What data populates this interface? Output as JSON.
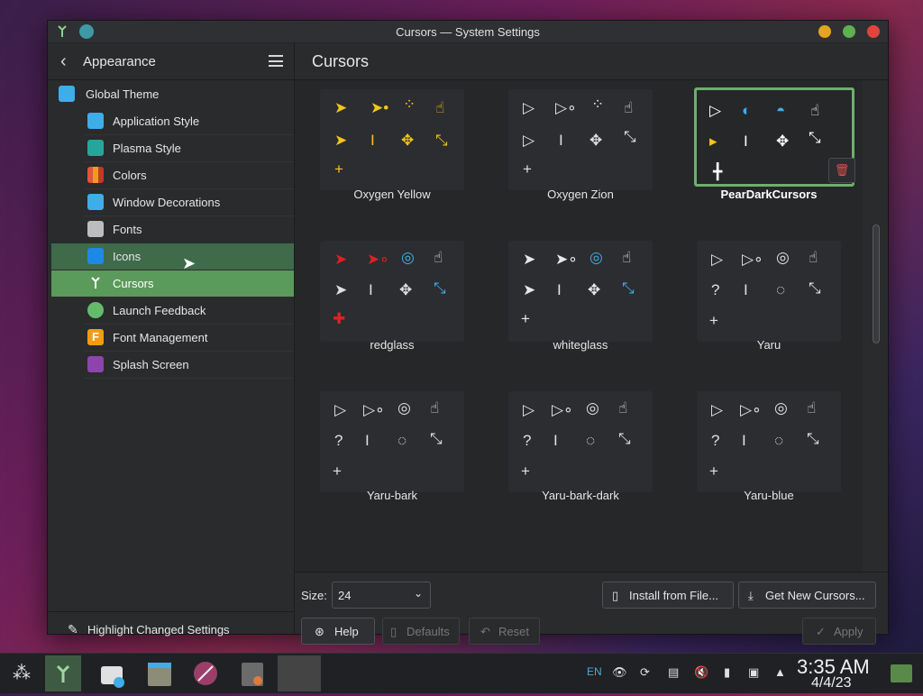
{
  "window": {
    "title": "Cursors — System Settings",
    "buttons": [
      "minimize",
      "maximize",
      "close"
    ]
  },
  "sidebar": {
    "back_icon": "chevron-left-icon",
    "title": "Appearance",
    "menu_icon": "hamburger-icon",
    "items": [
      {
        "label": "Global Theme",
        "icon": "global-theme-icon",
        "color": "#3daee9"
      },
      {
        "label": "Application Style",
        "icon": "application-style-icon",
        "color": "#3daee9"
      },
      {
        "label": "Plasma Style",
        "icon": "plasma-style-icon",
        "color": "#26a69a"
      },
      {
        "label": "Colors",
        "icon": "colors-icon",
        "color": "#e5533d"
      },
      {
        "label": "Window Decorations",
        "icon": "window-decorations-icon",
        "color": "#3daee9"
      },
      {
        "label": "Fonts",
        "icon": "fonts-icon",
        "color": "#9e9e9e"
      },
      {
        "label": "Icons",
        "icon": "icons-icon",
        "color": "#1e88e5"
      },
      {
        "label": "Cursors",
        "icon": "cursors-icon",
        "color": "#e8e8e8"
      },
      {
        "label": "Launch Feedback",
        "icon": "launch-feedback-icon",
        "color": "#66bb6a"
      },
      {
        "label": "Font Management",
        "icon": "font-management-icon",
        "color": "#f39c12"
      },
      {
        "label": "Splash Screen",
        "icon": "splash-screen-icon",
        "color": "#8e44ad"
      }
    ],
    "active": "Cursors",
    "hovered": "Icons",
    "footer": {
      "label": "Highlight Changed Settings",
      "icon": "pen-icon"
    }
  },
  "main": {
    "title": "Cursors",
    "themes": [
      {
        "name": "Oxygen Yellow",
        "color": "#f5c518",
        "selected": false
      },
      {
        "name": "Oxygen Zion",
        "color": "#e0e0e0",
        "selected": false
      },
      {
        "name": "PearDarkCursors",
        "color": "#ffffff",
        "selected": true
      },
      {
        "name": "redglass",
        "color": "#d22",
        "selected": false
      },
      {
        "name": "whiteglass",
        "color": "#e8e8e8",
        "selected": false
      },
      {
        "name": "Yaru",
        "color": "#e0e0e0",
        "selected": false
      },
      {
        "name": "Yaru-bark",
        "color": "#e0e0e0",
        "selected": false
      },
      {
        "name": "Yaru-bark-dark",
        "color": "#e0e0e0",
        "selected": false
      },
      {
        "name": "Yaru-blue",
        "color": "#e0e0e0",
        "selected": false
      }
    ],
    "size_label": "Size:",
    "size_value": "24",
    "install_button": "Install from File...",
    "get_new_button": "Get New Cursors...",
    "help_button": "Help",
    "defaults_button": "Defaults",
    "reset_button": "Reset",
    "apply_button": "Apply",
    "delete_icon": "trash-icon"
  },
  "taskbar": {
    "apps": [
      "application-launcher-icon",
      "system-settings-icon",
      "discover-store-icon",
      "file-manager-icon",
      "web-browser-icon",
      "settings-utility-icon",
      "blank-app-icon"
    ],
    "keyboard_layout": "EN",
    "tray_icons": [
      "eye-icon",
      "update-icon",
      "clipboard-icon",
      "volume-muted-icon",
      "usb-icon",
      "screen-icon",
      "expand-tray-icon"
    ],
    "time": "3:35 AM",
    "date": "4/4/23",
    "show_desktop_icon": "show-desktop-icon"
  }
}
